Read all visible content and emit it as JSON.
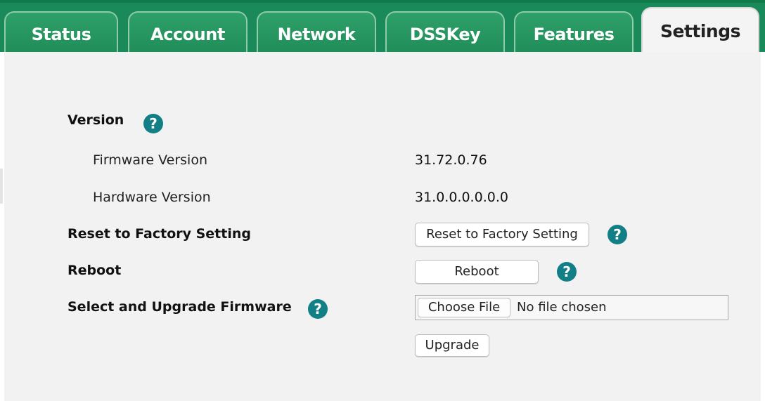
{
  "tabs": [
    {
      "label": "Status",
      "active": false
    },
    {
      "label": "Account",
      "active": false
    },
    {
      "label": "Network",
      "active": false
    },
    {
      "label": "DSSKey",
      "active": false
    },
    {
      "label": "Features",
      "active": false
    },
    {
      "label": "Settings",
      "active": true
    }
  ],
  "version": {
    "heading": "Version",
    "firmware_label": "Firmware Version",
    "firmware_value": "31.72.0.76",
    "hardware_label": "Hardware Version",
    "hardware_value": "31.0.0.0.0.0.0"
  },
  "reset": {
    "label": "Reset to Factory Setting",
    "button_label": "Reset to Factory Setting"
  },
  "reboot": {
    "label": "Reboot",
    "button_label": "Reboot"
  },
  "upgrade": {
    "label": "Select and Upgrade Firmware",
    "choose_file_label": "Choose File",
    "file_status": "No file chosen",
    "button_label": "Upgrade"
  },
  "help_icon_glyph": "?",
  "colors": {
    "tab_bar": "#1b8a5a",
    "help_icon": "#127f86",
    "content_bg": "#f2f2f2"
  }
}
